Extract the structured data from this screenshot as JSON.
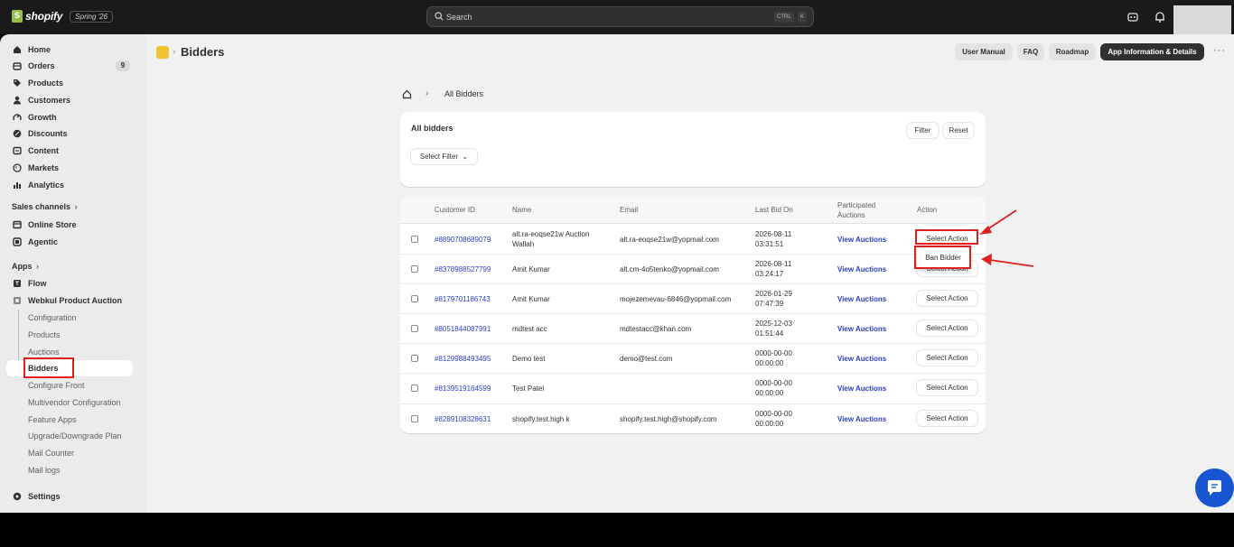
{
  "topbar": {
    "logo_text": "shopify",
    "version_badge": "Spring '26",
    "search_placeholder": "Search",
    "shortcut_ctrl": "CTRL",
    "shortcut_key": "K"
  },
  "sidebar": {
    "main_items": [
      {
        "label": "Home",
        "icon": "home-icon"
      },
      {
        "label": "Orders",
        "icon": "orders-icon",
        "badge": "9"
      },
      {
        "label": "Products",
        "icon": "tag-icon"
      },
      {
        "label": "Customers",
        "icon": "person-icon"
      },
      {
        "label": "Growth",
        "icon": "growth-icon"
      },
      {
        "label": "Discounts",
        "icon": "discount-icon"
      },
      {
        "label": "Content",
        "icon": "content-icon"
      },
      {
        "label": "Markets",
        "icon": "globe-icon"
      },
      {
        "label": "Analytics",
        "icon": "chart-icon"
      }
    ],
    "sales_channels_label": "Sales channels",
    "sales_channels": [
      {
        "label": "Online Store",
        "icon": "store-icon"
      },
      {
        "label": "Agentic",
        "icon": "agentic-icon"
      }
    ],
    "apps_label": "Apps",
    "apps": [
      {
        "label": "Flow",
        "icon": "flow-icon"
      },
      {
        "label": "Webkul Product Auction",
        "icon": "app-icon"
      }
    ],
    "app_subitems": [
      "Configuration",
      "Products",
      "Auctions",
      "Bidders",
      "Configure Front",
      "Multivendor Configuration",
      "Feature Apps",
      "Upgrade/Downgrade Plan",
      "Mail Counter",
      "Mail logs"
    ],
    "settings_label": "Settings"
  },
  "header": {
    "title": "Bidders",
    "buttons": [
      "User Manual",
      "FAQ",
      "Roadmap",
      "App Information & Details"
    ]
  },
  "breadcrumb": {
    "current": "All Bidders"
  },
  "filter_card": {
    "title": "All bidders",
    "filter_button": "Filter",
    "reset_button": "Reset",
    "select_filter": "Select Filter"
  },
  "table": {
    "headers": [
      "Customer ID",
      "Name",
      "Email",
      "Last Bid On",
      "Participated Auctions",
      "Action"
    ],
    "rows": [
      {
        "id": "#8890708689079",
        "name": "alt.ra-eoqse21w Auction Wallah",
        "email": "alt.ra-eoqse21w@yopmail.com",
        "date": "2026-08-11",
        "time": "03:31:51",
        "view": "View Auctions",
        "action": "Select Action"
      },
      {
        "id": "#8378988527799",
        "name": "Amit Kumar",
        "email": "alt.cm-4o5tenko@yopmail.com",
        "date": "2026-08-11",
        "time": "03:24:17",
        "view": "View Auctions",
        "action": "Select Action"
      },
      {
        "id": "#8179701186743",
        "name": "Amit Kumar",
        "email": "mojezemevau-6846@yopmail.com",
        "date": "2026-01-29",
        "time": "07:47:39",
        "view": "View Auctions",
        "action": "Select Action"
      },
      {
        "id": "#8051844087991",
        "name": "mdtest acc",
        "email": "mdtestacc@khan.com",
        "date": "2025-12-03",
        "time": "01:51:44",
        "view": "View Auctions",
        "action": "Select Action"
      },
      {
        "id": "#8129988493495",
        "name": "Demo test",
        "email": "demo@test.com",
        "date": "0000-00-00",
        "time": "00:00:00",
        "view": "View Auctions",
        "action": "Select Action"
      },
      {
        "id": "#8139519164599",
        "name": "Test Patel",
        "email": "",
        "date": "0000-00-00",
        "time": "00:00:00",
        "view": "View Auctions",
        "action": "Select Action"
      },
      {
        "id": "#8289108328631",
        "name": "shopify.test.high k",
        "email": "shopify.test.high@shopify.com",
        "date": "0000-00-00",
        "time": "00:00:00",
        "view": "View Auctions",
        "action": "Select Action"
      }
    ]
  },
  "dropdown": {
    "ban_bidder": "Ban Bidder"
  },
  "colors": {
    "highlight": "#e0201f",
    "link": "#2c40c5",
    "chat": "#1755d1"
  }
}
